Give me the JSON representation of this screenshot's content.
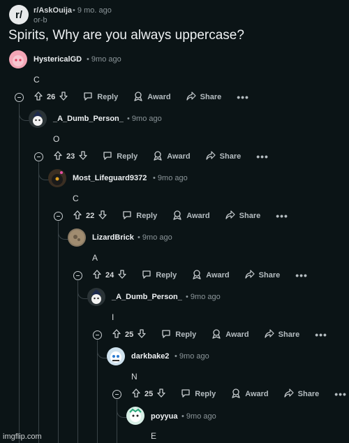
{
  "post": {
    "subreddit": "r/AskOuija",
    "time": "• 9 mo. ago",
    "author": "or-b",
    "title": "Spirits, Why are you always uppercase?"
  },
  "comments": [
    {
      "user": "HystericalGD",
      "time": "• 9mo ago",
      "text": "C",
      "votes": "26"
    },
    {
      "user": "_A_Dumb_Person_",
      "time": "• 9mo ago",
      "text": "O",
      "votes": "23"
    },
    {
      "user": "Most_Lifeguard9372",
      "time": "• 9mo ago",
      "text": "C",
      "votes": "22"
    },
    {
      "user": "LizardBrick",
      "time": "• 9mo ago",
      "text": "A",
      "votes": "24"
    },
    {
      "user": "_A_Dumb_Person_",
      "time": "• 9mo ago",
      "text": "I",
      "votes": "25"
    },
    {
      "user": "darkbake2",
      "time": "• 9mo ago",
      "text": "N",
      "votes": "25"
    },
    {
      "user": "poyyua",
      "time": "• 9mo ago",
      "text": "E"
    }
  ],
  "actions": {
    "reply": "Reply",
    "award": "Award",
    "share": "Share",
    "more": "•••"
  },
  "colors": {
    "background": "#0b1416",
    "text": "#d7dadc",
    "muted": "#8b9599",
    "thread": "#3a4448"
  },
  "watermark": "imgflip.com"
}
